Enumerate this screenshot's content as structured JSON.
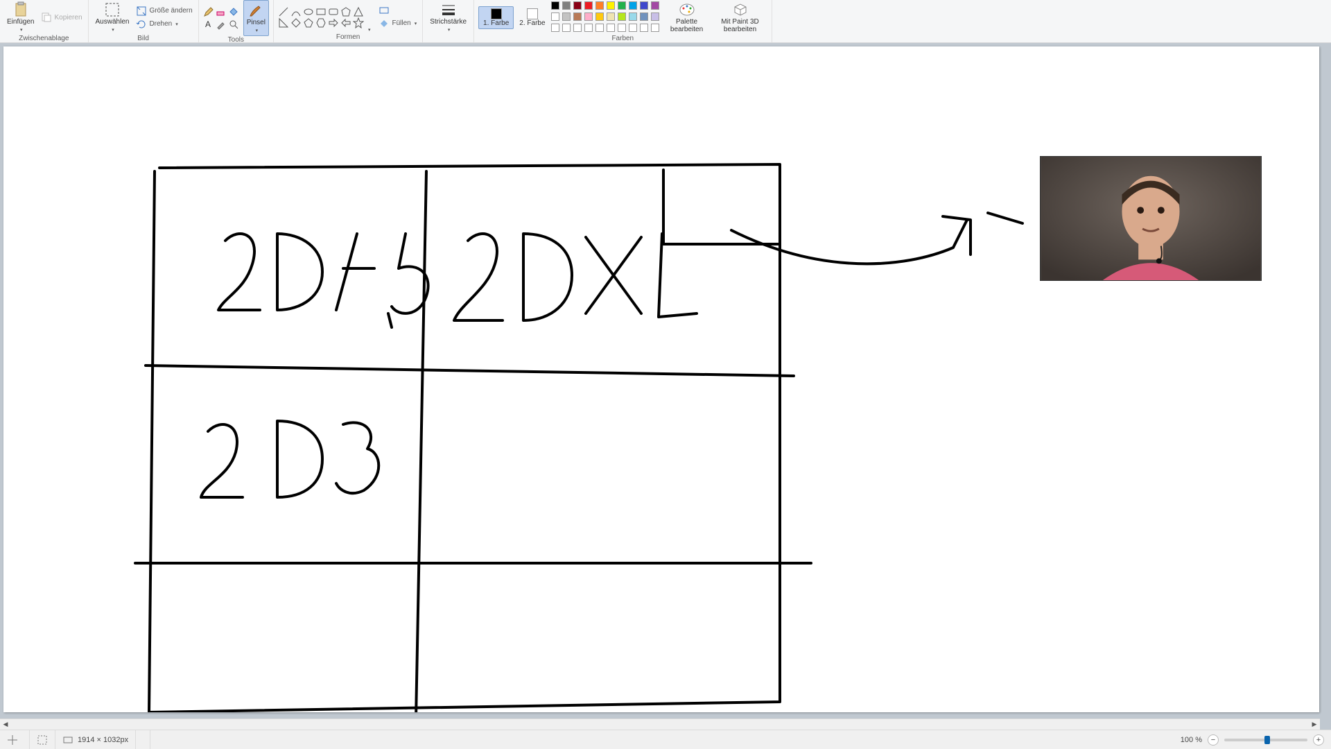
{
  "ribbon": {
    "clipboard": {
      "label": "Zwischenablage",
      "paste": "Einfügen",
      "copy": "Kopieren"
    },
    "image": {
      "label": "Bild",
      "select": "Auswählen",
      "resize": "Größe ändern",
      "rotate": "Drehen"
    },
    "tools": {
      "label": "Tools",
      "brush": "Pinsel"
    },
    "shapes": {
      "label": "Formen",
      "fill": "Füllen"
    },
    "stroke": {
      "label": "Strichstärke"
    },
    "colors": {
      "label": "Farben",
      "color1": "1. Farbe",
      "color2": "2. Farbe",
      "editPalette": "Palette bearbeiten",
      "paint3d": "Mit Paint 3D bearbeiten",
      "palette": [
        "#000000",
        "#7f7f7f",
        "#880015",
        "#ed1c24",
        "#ff7f27",
        "#fff200",
        "#22b14c",
        "#00a2e8",
        "#3f48cc",
        "#a349a4",
        "#ffffff",
        "#c3c3c3",
        "#b97a57",
        "#ffaec9",
        "#ffc90e",
        "#efe4b0",
        "#b5e61d",
        "#99d9ea",
        "#7092be",
        "#c8bfe7",
        "#ffffff",
        "#ffffff",
        "#ffffff",
        "#ffffff",
        "#ffffff",
        "#ffffff",
        "#ffffff",
        "#ffffff",
        "#ffffff",
        "#ffffff"
      ]
    }
  },
  "canvas": {
    "cell_top_left": "SD 1,5",
    "cell_top_right": "SDXL",
    "cell_mid_left": "SD3"
  },
  "status": {
    "cursor": "",
    "dimensions": "1914 × 1032px",
    "zoom": "100 %"
  }
}
